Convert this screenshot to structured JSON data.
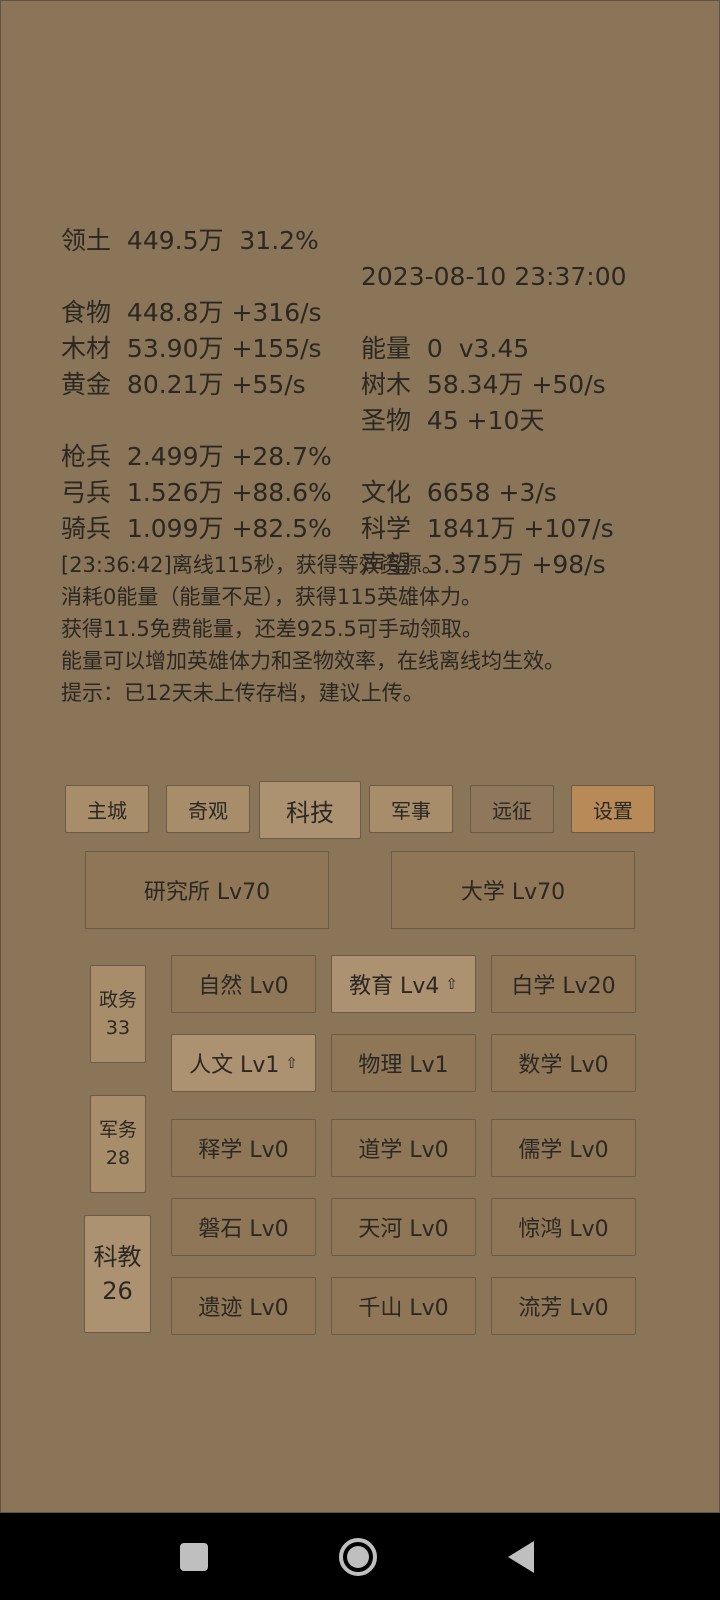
{
  "territory": {
    "label": "领土",
    "value": "449.5万  31.2%",
    "datetime": "2023-08-10 23:37:00"
  },
  "resources": [
    {
      "l_label": "食物",
      "l_value": "448.8万 +316/s",
      "r_label": "能量",
      "r_value": "0  v3.45"
    },
    {
      "l_label": "木材",
      "l_value": "53.90万 +155/s",
      "r_label": "树木",
      "r_value": "58.34万 +50/s"
    },
    {
      "l_label": "黄金",
      "l_value": "80.21万 +55/s",
      "r_label": "圣物",
      "r_value": "45 +10天"
    }
  ],
  "military": [
    {
      "l_label": "枪兵",
      "l_value": "2.499万 +28.7%",
      "r_label": "文化",
      "r_value": "6658 +3/s"
    },
    {
      "l_label": "弓兵",
      "l_value": "1.526万 +88.6%",
      "r_label": "科学",
      "r_value": "1841万 +107/s"
    },
    {
      "l_label": "骑兵",
      "l_value": "1.099万 +82.5%",
      "r_label": "声望",
      "r_value": "3.375万 +98/s"
    }
  ],
  "log": [
    "[23:36:42]离线115秒，获得等效资源。",
    "消耗0能量（能量不足），获得115英雄体力。",
    "获得11.5免费能量，还差925.5可手动领取。",
    "能量可以增加英雄体力和圣物效率，在线离线均生效。",
    "提示：已12天未上传存档，建议上传。"
  ],
  "tabs": [
    "主城",
    "奇观",
    "科技",
    "军事",
    "远征",
    "设置"
  ],
  "buildings": [
    "研究所 Lv70",
    "大学 Lv70"
  ],
  "side": [
    {
      "label": "政务",
      "count": "33"
    },
    {
      "label": "军务",
      "count": "28"
    },
    {
      "label": "科教",
      "count": "26"
    }
  ],
  "tech": [
    {
      "name": "自然 Lv0",
      "arrow": ""
    },
    {
      "name": "教育 Lv4",
      "arrow": "⇧"
    },
    {
      "name": "白学 Lv20",
      "arrow": ""
    },
    {
      "name": "人文 Lv1",
      "arrow": "⇧"
    },
    {
      "name": "物理 Lv1",
      "arrow": ""
    },
    {
      "name": "数学 Lv0",
      "arrow": ""
    },
    {
      "name": "释学 Lv0",
      "arrow": ""
    },
    {
      "name": "道学 Lv0",
      "arrow": ""
    },
    {
      "name": "儒学 Lv0",
      "arrow": ""
    },
    {
      "name": "磐石 Lv0",
      "arrow": ""
    },
    {
      "name": "天河 Lv0",
      "arrow": ""
    },
    {
      "name": "惊鸿 Lv0",
      "arrow": ""
    },
    {
      "name": "遗迹 Lv0",
      "arrow": ""
    },
    {
      "name": "千山 Lv0",
      "arrow": ""
    },
    {
      "name": "流芳 Lv0",
      "arrow": ""
    }
  ],
  "nav": {
    "recents_icon": "square-icon",
    "home_icon": "circle-icon",
    "back_icon": "triangle-back-icon"
  }
}
